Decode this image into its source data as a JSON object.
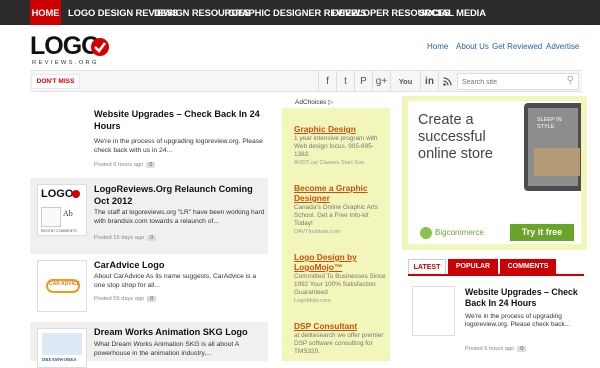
{
  "topnav": {
    "items": [
      "HOME",
      "LOGO DESIGN REVIEWS",
      "DESIGN RESOURCES",
      "GRAPHIC DESIGNER REVIEWS",
      "DEVELOPER RESOURCES",
      "SOCIAL MEDIA"
    ]
  },
  "logo": {
    "text": "LOGO",
    "subtext": "REVIEWS.ORG"
  },
  "toplinks": [
    "Home",
    "About Us",
    "Get Reviewed",
    "Advertise"
  ],
  "bar": {
    "dont_miss": "DON'T MISS",
    "social": [
      "f",
      "t",
      "P",
      "g+",
      "You",
      "in",
      "rss"
    ],
    "search_placeholder": "Search site"
  },
  "articles": [
    {
      "title": "Website Upgrades – Check Back In 24 Hours",
      "excerpt": "We're in the process of upgrading logoreview.org. Please check back with us in 24...",
      "meta": "Posted 6 hours ago",
      "comments": "0"
    },
    {
      "title": "LogoReviews.Org Relaunch Coming Oct 2012",
      "excerpt": "The staff at logoreviews.org \"LR\" have been working hard with brandsix.com towards a relaunch of...",
      "meta": "Posted 16 days ago",
      "comments": "0",
      "thumb_caption": "RECENT COMMENTS"
    },
    {
      "title": "CarAdvice Logo",
      "excerpt": "About CarAdvice As its name suggests, CarAdvice is a one stop shop for all...",
      "meta": "Posted 55 days ago",
      "comments": "0",
      "thumb_caption": "CAR ADVICE"
    },
    {
      "title": "Dream Works Animation SKG Logo",
      "excerpt": "What Dream Works Animation SKG is all about A powerhouse in the animation industry,...",
      "thumb_caption": "DREAMWORKS"
    }
  ],
  "ads": {
    "adchoices": "AdChoices",
    "items": [
      {
        "title": "Graphic Design",
        "desc": "1 year intensive program with Web design focus. 905-695-1383.",
        "url": "AODT.ca/ Classes Start Soo"
      },
      {
        "title": "Become a Graphic Designer",
        "desc": "Canada's Online Graphic Arts School. Get a Free Info-kit Today!",
        "url": "DAVTInstitute.com"
      },
      {
        "title": "Logo Design by LogoMojo™",
        "desc": "Committed To Businesses Since 1992 Your 100% Satisfaction Guaranteed",
        "url": "LogoMojo.com"
      },
      {
        "title": "DSP Consultant",
        "desc": "at delitesearch we offer premier DSP software consulting for TMS320.",
        "url": ""
      }
    ]
  },
  "banner": {
    "headline": "Create a successful online store",
    "phone_text": "SLEEP IN STYLE",
    "brand": "Bigcommerce",
    "cta": "Try it free",
    "brand_color": "#6aa52a"
  },
  "tabs": [
    "LATEST",
    "POPULAR",
    "COMMENTS"
  ],
  "latest": {
    "title": "Website Upgrades – Check Back In 24 Hours",
    "excerpt": "We're in the process of upgrading logoreview.org. Please check back...",
    "meta": "Posted 6 hours ago",
    "comments": "0"
  },
  "colors": {
    "accent": "#cc0000",
    "nav_bg": "#2b2b2b",
    "ad_bg": "#f2f6ba",
    "ad_link": "#c8500b"
  }
}
